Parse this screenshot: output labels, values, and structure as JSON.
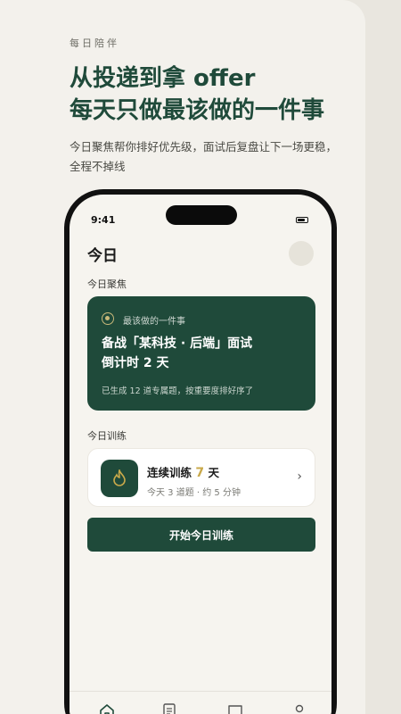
{
  "hero": {
    "eyebrow": "每日陪伴",
    "headline_line1": "从投递到拿 offer",
    "headline_line2": "每天只做最该做的一件事",
    "subtext": "今日聚焦帮你排好优先级，面试后复盘让下一场更稳，全程不掉线"
  },
  "status": {
    "time": "9:41"
  },
  "page": {
    "title": "今日"
  },
  "focus": {
    "section_label": "今日聚焦",
    "eyebrow": "最该做的一件事",
    "title_line1": "备战「某科技 · 后端」面试",
    "title_line2": "倒计时 2 天",
    "desc": "已生成 12 道专属题，按重要度排好序了"
  },
  "training": {
    "section_label": "今日训练",
    "title_prefix": "连续训练",
    "streak": "7",
    "title_suffix": "天",
    "sub": "今天 3 道题 · 约 5 分钟",
    "chevron": "›",
    "start_label": "开始今日训练"
  },
  "colors": {
    "brand": "#1f4a3a",
    "accent": "#c9a94a"
  },
  "tabs": [
    "home-icon",
    "document-icon",
    "chat-icon",
    "profile-icon"
  ]
}
